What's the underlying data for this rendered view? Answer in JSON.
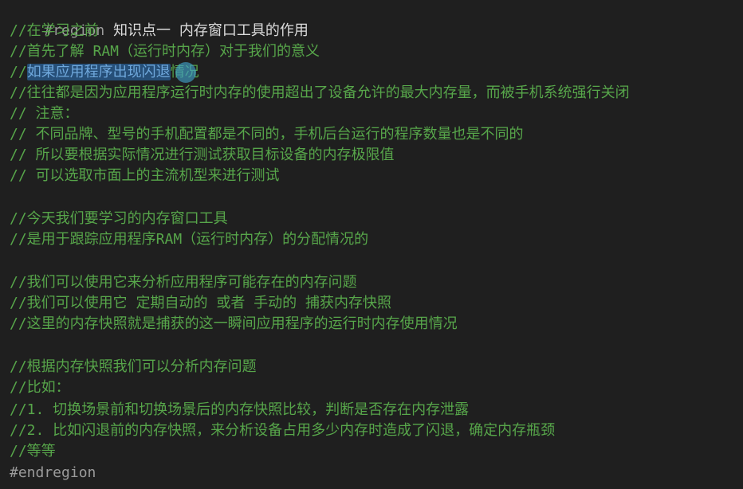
{
  "editor": {
    "lines": [
      {
        "kind": "region",
        "prefix": "#region ",
        "text": "知识点一 内存窗口工具的作用"
      },
      {
        "kind": "comment",
        "text": "//在学习之前"
      },
      {
        "kind": "comment",
        "text": "//首先了解 RAM（运行时内存）对于我们的意义"
      },
      {
        "kind": "selected",
        "before": "//",
        "selected": "如果应用程序出现闪退",
        "after": "情况"
      },
      {
        "kind": "comment",
        "text": "//往往都是因为应用程序运行时内存的使用超出了设备允许的最大内存量，而被手机系统强行关闭"
      },
      {
        "kind": "comment",
        "text": "// 注意："
      },
      {
        "kind": "comment",
        "text": "// 不同品牌、型号的手机配置都是不同的，手机后台运行的程序数量也是不同的"
      },
      {
        "kind": "comment",
        "text": "// 所以要根据实际情况进行测试获取目标设备的内存极限值"
      },
      {
        "kind": "comment",
        "text": "// 可以选取市面上的主流机型来进行测试"
      },
      {
        "kind": "blank",
        "text": ""
      },
      {
        "kind": "comment",
        "text": "//今天我们要学习的内存窗口工具"
      },
      {
        "kind": "comment",
        "text": "//是用于跟踪应用程序RAM（运行时内存）的分配情况的"
      },
      {
        "kind": "blank",
        "text": ""
      },
      {
        "kind": "comment",
        "text": "//我们可以使用它来分析应用程序可能存在的内存问题"
      },
      {
        "kind": "comment",
        "text": "//我们可以使用它 定期自动的 或者 手动的 捕获内存快照"
      },
      {
        "kind": "comment",
        "text": "//这里的内存快照就是捕获的这一瞬间应用程序的运行时内存使用情况"
      },
      {
        "kind": "blank",
        "text": ""
      },
      {
        "kind": "comment",
        "text": "//根据内存快照我们可以分析内存问题"
      },
      {
        "kind": "comment",
        "text": "//比如："
      },
      {
        "kind": "comment",
        "text": "//1. 切换场景前和切换场景后的内存快照比较，判断是否存在内存泄露"
      },
      {
        "kind": "comment",
        "text": "//2. 比如闪退前的内存快照，来分析设备占用多少内存时造成了闪退，确定内存瓶颈"
      },
      {
        "kind": "comment",
        "text": "//等等"
      },
      {
        "kind": "endregion",
        "text": "#endregion"
      }
    ]
  },
  "colors": {
    "background": "#1f1f1f",
    "comment": "#57a64a",
    "keyword": "#9b9b9b",
    "selection": "#264f78"
  }
}
